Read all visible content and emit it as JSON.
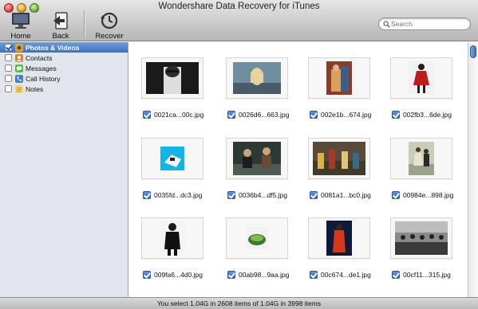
{
  "window": {
    "title": "Wondershare Data Recovery for iTunes"
  },
  "toolbar": {
    "home_label": "Home",
    "back_label": "Back",
    "recover_label": "Recover"
  },
  "search": {
    "placeholder": "Search",
    "value": ""
  },
  "sidebar": {
    "items": [
      {
        "label": "Photos & Videos",
        "checked": true,
        "selected": true,
        "icon": "photos-icon"
      },
      {
        "label": "Contacts",
        "checked": false,
        "selected": false,
        "icon": "contacts-icon"
      },
      {
        "label": "Messages",
        "checked": false,
        "selected": false,
        "icon": "messages-icon"
      },
      {
        "label": "Call History",
        "checked": false,
        "selected": false,
        "icon": "call-history-icon"
      },
      {
        "label": "Notes",
        "checked": false,
        "selected": false,
        "icon": "notes-icon"
      }
    ]
  },
  "files": [
    {
      "name": "0021ca...00c.jpg",
      "checked": true
    },
    {
      "name": "0026d6...663.jpg",
      "checked": true
    },
    {
      "name": "002e1b...674.jpg",
      "checked": true
    },
    {
      "name": "002fb3...6de.jpg",
      "checked": true
    },
    {
      "name": "0035fd...dc3.jpg",
      "checked": true
    },
    {
      "name": "0036b4...df5.jpg",
      "checked": true
    },
    {
      "name": "0081a1...bc0.jpg",
      "checked": true
    },
    {
      "name": "00984e...898.jpg",
      "checked": true
    },
    {
      "name": "009fa6...4d0.jpg",
      "checked": true
    },
    {
      "name": "00ab98...9aa.jpg",
      "checked": true
    },
    {
      "name": "00c674...de1.jpg",
      "checked": true
    },
    {
      "name": "00cf11...315.jpg",
      "checked": true
    }
  ],
  "status": {
    "text": "You select 1.04G in 2608 items of 1.04G in 3998 items"
  },
  "colors": {
    "accent": "#3d72c4",
    "sidebar_bg": "#e2e6ec"
  }
}
